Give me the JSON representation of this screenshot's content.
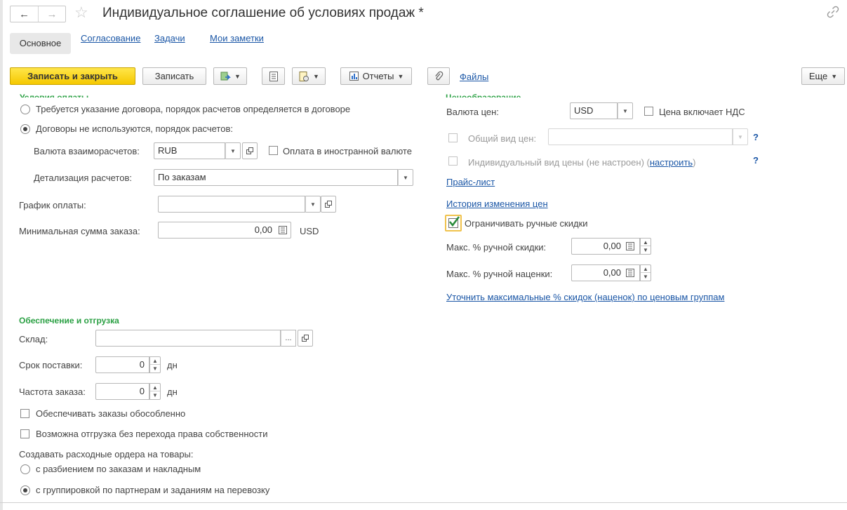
{
  "window": {
    "title": "Индивидуальное соглашение об условиях продаж *"
  },
  "tabs": [
    {
      "label": "Основное",
      "active": true
    },
    {
      "label": "Согласование"
    },
    {
      "label": "Задачи"
    },
    {
      "label": "Мои заметки"
    }
  ],
  "toolbar": {
    "save_close": "Записать и закрыть",
    "save": "Записать",
    "reports": "Отчеты",
    "files": "Файлы",
    "more": "Еще"
  },
  "payment": {
    "group_title": "Условия оплаты",
    "radio_contract": "Требуется указание договора, порядок расчетов определяется в договоре",
    "radio_no_contract": "Договоры не используются, порядок расчетов:",
    "currency_label": "Валюта взаиморасчетов:",
    "currency_value": "RUB",
    "foreign_label": "Оплата в иностранной валюте",
    "detail_label": "Детализация расчетов:",
    "detail_value": "По заказам",
    "schedule_label": "График оплаты:",
    "schedule_value": "",
    "min_label": "Минимальная сумма заказа:",
    "min_value": "0,00",
    "min_unit": "USD"
  },
  "pricing": {
    "group_title": "Ценообразование",
    "currency_label": "Валюта цен:",
    "currency_value": "USD",
    "vat_label": "Цена включает НДС",
    "general_label": "Общий вид цен:",
    "general_value": "",
    "qmark": "?",
    "individual_label": "Индивидуальный вид цены (не настроен) (",
    "individual_link": "настроить",
    "individual_tail": ")",
    "price_list_link": "Прайс-лист",
    "history_link": "История изменения цен",
    "limit_label": "Ограничивать ручные скидки",
    "max_discount_label": "Макс. % ручной скидки:",
    "max_discount_value": "0,00",
    "max_markup_label": "Макс. % ручной наценки:",
    "max_markup_value": "0,00",
    "refine_link": "Уточнить максимальные % скидок (наценок) по ценовым группам"
  },
  "shipping": {
    "group_title": "Обеспечение и отгрузка",
    "warehouse_label": "Склад:",
    "warehouse_value": "",
    "ellipsis": "...",
    "term_label": "Срок поставки:",
    "term_value": "0",
    "term_unit": "дн",
    "freq_label": "Частота заказа:",
    "freq_value": "0",
    "freq_unit": "дн",
    "separate_label": "Обеспечивать заказы обособленно",
    "no_ownership_label": "Возможна отгрузка без перехода права собственности",
    "orders_label": "Создавать расходные ордера на товары:",
    "radio_split": "с разбиением по заказам и накладным",
    "radio_group": "с группировкой по партнерам и заданиям на перевозку"
  },
  "colors": {
    "accent_yellow": "#f5c800",
    "group_green": "#2aa043",
    "link_blue": "#1a56a6"
  }
}
